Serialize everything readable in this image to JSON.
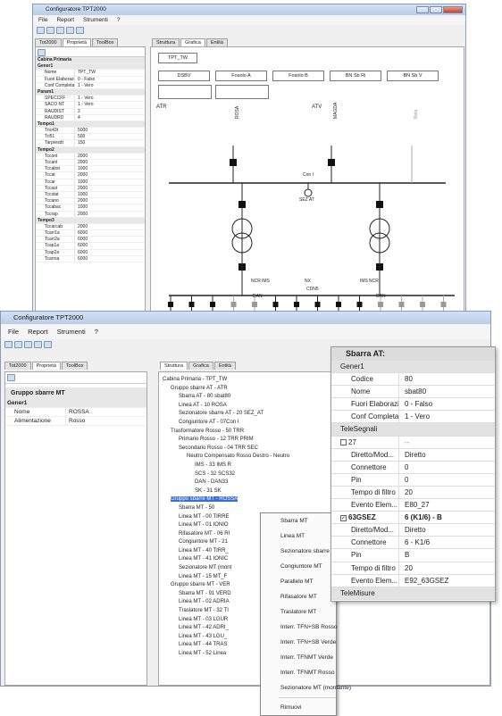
{
  "back": {
    "title": "Configuratore TPT2000",
    "menu": [
      "File",
      "Report",
      "Strumenti",
      "?"
    ],
    "left_tabs": [
      "Tot2000",
      "Proprietà",
      "ToolBox"
    ],
    "right_tabs": [
      "Struttura",
      "Grafica",
      "Entità"
    ],
    "props": [
      {
        "c": true,
        "k": "Cabina Primaria"
      },
      {
        "c": true,
        "k": "Gener1"
      },
      {
        "k": "Nome",
        "v": "TPT_TW"
      },
      {
        "k": "Fuori Elaborazi...",
        "v": "0 - Falso"
      },
      {
        "k": "Conf Completa",
        "v": "1 - Vero"
      },
      {
        "c": true,
        "k": "Param1"
      },
      {
        "k": "SPECCFF",
        "v": "1 - Vero"
      },
      {
        "k": "SACO NT",
        "v": "1 - Vero"
      },
      {
        "k": "RAUDIST",
        "v": "2"
      },
      {
        "k": "RAUDRD",
        "v": "4"
      },
      {
        "c": true,
        "k": "Tempo1"
      },
      {
        "k": "Tric43t",
        "v": "5000"
      },
      {
        "k": "Tri51",
        "v": "500"
      },
      {
        "k": "Tarpresdt",
        "v": "150"
      },
      {
        "c": true,
        "k": "Tempo2"
      },
      {
        "k": "Tccont",
        "v": "2000"
      },
      {
        "k": "Tccant",
        "v": "2000"
      },
      {
        "k": "Tccabst",
        "v": "1000"
      },
      {
        "k": "Tccat",
        "v": "2000"
      },
      {
        "k": "Tccar",
        "v": "1000"
      },
      {
        "k": "Tccast",
        "v": "2000"
      },
      {
        "k": "Tccstat",
        "v": "1000"
      },
      {
        "k": "Tccano",
        "v": "2000"
      },
      {
        "k": "Tccabac",
        "v": "1000"
      },
      {
        "k": "Tccrap",
        "v": "2000"
      },
      {
        "c": true,
        "k": "Tempo3"
      },
      {
        "k": "Tccarcab",
        "v": "2000"
      },
      {
        "k": "Tcarr1a",
        "v": "6000"
      },
      {
        "k": "Tcarr2a",
        "v": "6000"
      },
      {
        "k": "Tcap1a",
        "v": "6000"
      },
      {
        "k": "Tcap2a",
        "v": "6000"
      },
      {
        "k": "Tcarrsa",
        "v": "6000"
      }
    ],
    "diagram": {
      "station": "TPT_TW",
      "boxes": [
        "DSBV",
        "Fosolo A",
        "Fosolo B",
        "BN Sb Ri",
        "BN Sb V"
      ],
      "atr": "ATR",
      "atv": "ATV",
      "top_feeders": [
        "ROSA",
        "MAGDA",
        "Beta"
      ],
      "con": "Con I",
      "sez": "SEZ AT",
      "labels": [
        "NCR",
        "IMS",
        "NX",
        "CDN5",
        "IMS",
        "NCR",
        "DAN",
        "DAN"
      ],
      "bottom_feeders": [
        "TIRREN",
        "IONIO",
        "RIFAS",
        "TIRR_DR",
        "IONIO_DR",
        "ma02",
        "MT_FT15",
        "ADRIATICO",
        "TAKEL",
        "LIGURE",
        "ASTR_SN",
        "TRAS_SN",
        "Linea MT12",
        "MT_FT12"
      ]
    }
  },
  "front": {
    "title": "Configuratore TPT2000",
    "menu": [
      "File",
      "Report",
      "Strumenti",
      "?"
    ],
    "left_tabs": [
      "Tot2000",
      "Proprietà",
      "ToolBox"
    ],
    "right_tabs": [
      "Struttura",
      "Grafica",
      "Entità"
    ],
    "props_header": "Gruppo sbarre MT",
    "props": [
      {
        "c": true,
        "k": "Gener1"
      },
      {
        "k": "Nome",
        "v": "ROSSA"
      },
      {
        "k": "Alimentazione",
        "v": "Rosso"
      }
    ],
    "tree": [
      "Cabina Primaria - TPT_TW",
      "Gruppo sbarre AT - ATR",
      "Sbarra AT - 80 sbat80",
      "Linea AT - 10 ROSA",
      "Sezionatore sbarre AT - 20 SEZ_AT",
      "Congiuntore AT - 07Con I",
      "Trasformatore Rosso - 50 TRR",
      "Primario Rosso - 12 TRR PRIM",
      "Secondario Rosso - 04 TRR SEC",
      "Neutro Compensato Rosso Destro - Neutro",
      "IMS - 33 IMS R",
      "SCS - 32 SCS32",
      "DAN - DAN33",
      "SK - 31 SK",
      "Gruppo sbarre MT - ROSSA",
      "Sbarra MT - 50",
      "Linea MT - 00 TIRRE",
      "Linea MT - 01 IONIO",
      "Rifasatore MT - 06 RI",
      "Congiuntore MT - 21",
      "Linea MT - 40 TIRR_",
      "Linea MT - 41 IONIC",
      "Sezionatore MT (mont",
      "Linea MT - 15 MT_F",
      "Gruppo sbarre MT - VER",
      "Sbarra MT - 91 VERD",
      "Linea MT - 02 ADRIA",
      "Traslatore MT - 32 TI",
      "Linea MT - 03 LGUR",
      "Linea MT - 42 ADRI_",
      "Linea MT - 43 LGU_",
      "Linea MT - 44 TRAS",
      "Linea MT - 52 Linea"
    ],
    "ctx": [
      "Sbarra MT",
      "Linea MT",
      "Sezionatore sbarre MT",
      "Congiuntore MT",
      "Parallelo MT",
      "Rifasatore MT",
      "Traslatore MT",
      "Interr. TFN+SB Rosso",
      "Interr. TFN+SB Verde",
      "Interr. TFNMT Verde",
      "Interr. TFNMT Rosso",
      "Sezionatore MT (montante)",
      "Rimuovi"
    ]
  },
  "zoom": {
    "title": "Sbarra AT:",
    "rows": [
      {
        "cat": true,
        "k": "Gener1"
      },
      {
        "k": "Codice",
        "v": "80"
      },
      {
        "k": "Nome",
        "v": "sbat80"
      },
      {
        "k": "Fuori Elaborazi...",
        "v": "0 - Falso"
      },
      {
        "k": "Conf Completa",
        "v": "1 - Vero"
      },
      {
        "cat": true,
        "k": "TeleSegnali"
      },
      {
        "k": "27",
        "v": "--",
        "chk": ""
      },
      {
        "k": "Diretto/Mod...",
        "v": "Diretto"
      },
      {
        "k": "Connettore",
        "v": "0"
      },
      {
        "k": "Pin",
        "v": "0"
      },
      {
        "k": "Tempo di filtro",
        "v": "20"
      },
      {
        "k": "Evento Elem...",
        "v": "E80_27"
      },
      {
        "k": "63GSEZ",
        "v": "6 (K1/6) - B",
        "chk": "✓",
        "bold": true
      },
      {
        "k": "Diretto/Mod...",
        "v": "Diretto"
      },
      {
        "k": "Connettore",
        "v": "6 - K1/6"
      },
      {
        "k": "Pin",
        "v": "B"
      },
      {
        "k": "Tempo di filtro",
        "v": "20"
      },
      {
        "k": "Evento Elem...",
        "v": "E92_63GSEZ"
      },
      {
        "cat": true,
        "k": "TeleMisure"
      }
    ]
  }
}
